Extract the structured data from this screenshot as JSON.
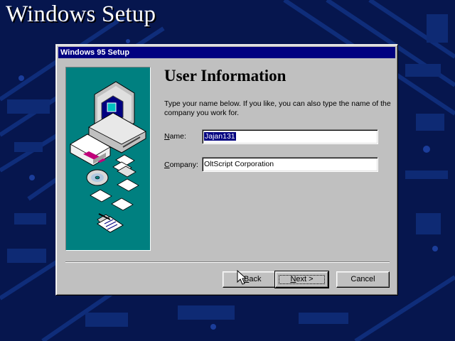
{
  "screen": {
    "title": "Windows Setup"
  },
  "dialog": {
    "title": "Windows 95 Setup",
    "heading": "User Information",
    "instructions": "Type your name below. If you like, you can also type the name of the company you work for.",
    "name_label": {
      "accel": "N",
      "rest": "ame:"
    },
    "name_value": "Jajan131",
    "company_label": {
      "accel": "C",
      "rest": "ompany:"
    },
    "company_value": "OltScript Corporation"
  },
  "buttons": {
    "back": {
      "prefix": "< ",
      "accel": "B",
      "rest": "ack"
    },
    "next": {
      "accel": "N",
      "rest": "ext >"
    },
    "cancel": "Cancel"
  },
  "colors": {
    "desktop": "#06164e",
    "titlebar": "#000080",
    "dialog_face": "#c0c0c0",
    "art_panel": "#008080"
  },
  "icons": [
    "computer-icon",
    "floppy-drive-icon",
    "floppy-disk-icon",
    "cd-rom-icon",
    "registration-card-icon",
    "mouse-pointer-icon"
  ]
}
